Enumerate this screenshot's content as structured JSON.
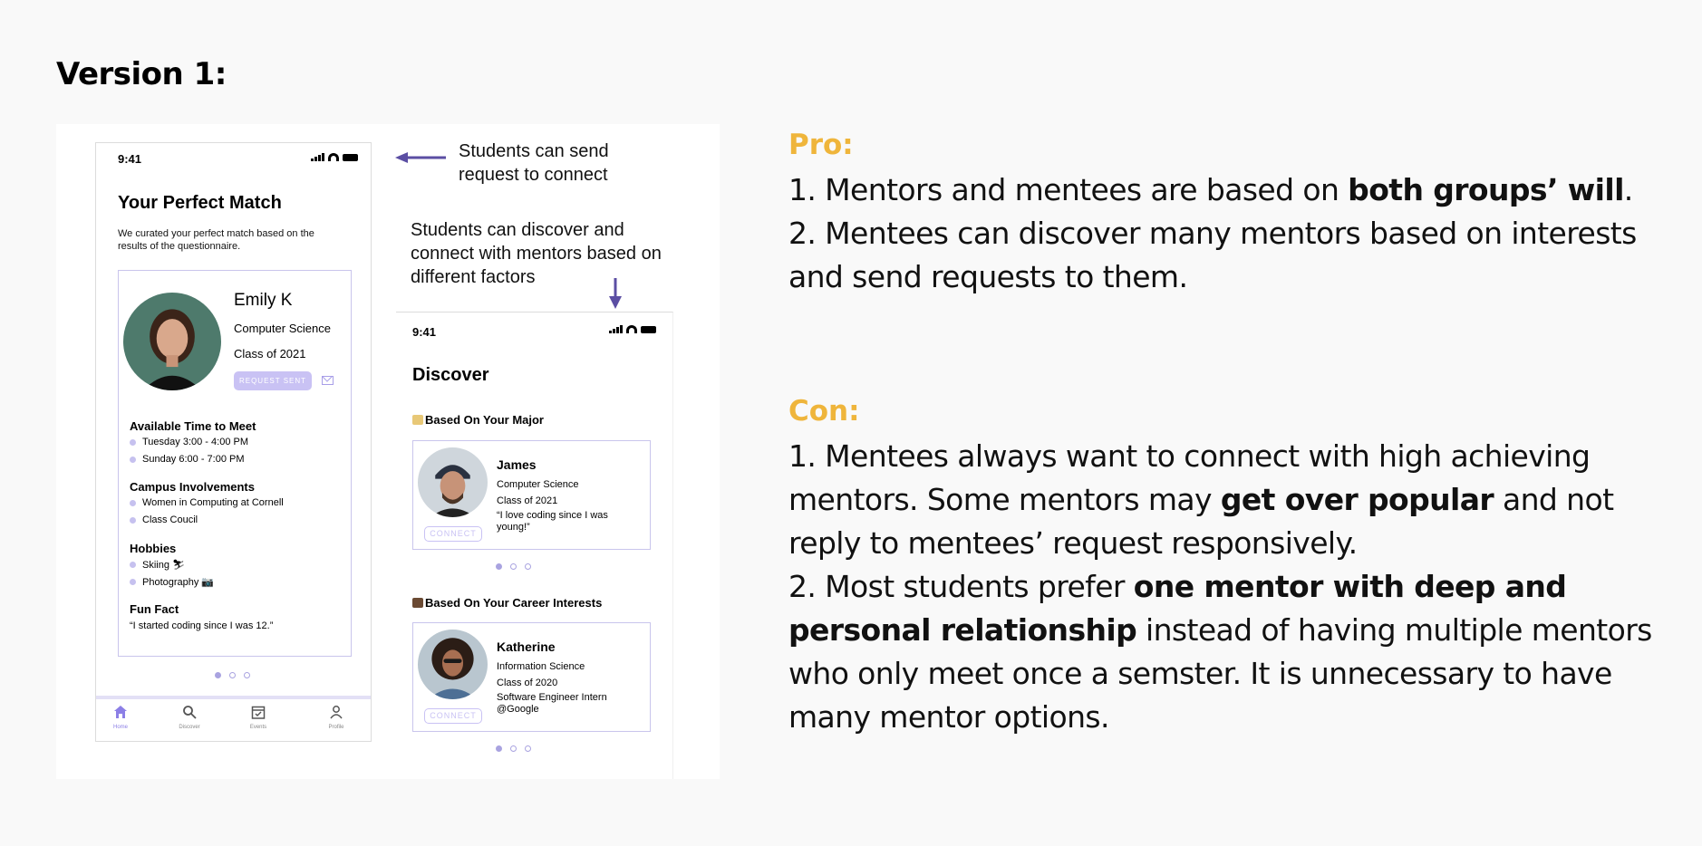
{
  "slide": {
    "title": "Version 1:"
  },
  "phone1": {
    "time": "9:41",
    "title": "Your Perfect Match",
    "subtitle": "We curated your perfect match based on the results of the questionnaire.",
    "profile": {
      "name": "Emily K",
      "major": "Computer Science",
      "class": "Class of 2021",
      "button": "REQUEST SENT"
    },
    "sections": [
      {
        "heading": "Available Time to Meet",
        "items": [
          "Tuesday 3:00 - 4:00 PM",
          "Sunday 6:00 - 7:00 PM"
        ]
      },
      {
        "heading": "Campus Involvements",
        "items": [
          "Women in Computing at Cornell",
          "Class Coucil"
        ]
      },
      {
        "heading": "Hobbies",
        "items": [
          "Skiing ⛷",
          "Photography 📷"
        ]
      },
      {
        "heading": "Fun Fact",
        "quote": "“I started coding since I was 12.”"
      }
    ],
    "tabs": [
      "Home",
      "Discover",
      "Events",
      "Profile"
    ]
  },
  "annotations": {
    "note1": "Students can send request to connect",
    "note2": "Students can discover and connect with mentors based on different factors"
  },
  "phone2": {
    "time": "9:41",
    "title": "Discover",
    "categories": [
      {
        "heading": "Based On Your Major",
        "mentor": {
          "name": "James",
          "major": "Computer Science",
          "class": "Class of 2021",
          "extra": "“I love coding since I was young!”",
          "button": "CONNECT"
        }
      },
      {
        "heading": "Based On Your Career Interests",
        "mentor": {
          "name": "Katherine",
          "major": "Information Science",
          "class": "Class of 2020",
          "extra": "Software Engineer Intern @Google",
          "button": "CONNECT"
        }
      }
    ]
  },
  "pro": {
    "label": "Pro:",
    "p1_pre": "1. Mentors and mentees are based on ",
    "p1_bold": "both groups’ will",
    "p1_post": ".",
    "p2": "2. Mentees can discover many mentors based on interests and send requests to them."
  },
  "con": {
    "label": "Con:",
    "p1_pre": "1. Mentees always want to connect with high achieving mentors. Some mentors may ",
    "p1_bold": "get over popular",
    "p1_post": " and not reply to mentees’ request responsively.",
    "p2_pre": "2. Most students prefer ",
    "p2_bold": "one mentor with deep and personal relationship",
    "p2_post": " instead of having multiple mentors who only meet once a semster. It is unnecessary to have many mentor options."
  },
  "colors": {
    "accent": "#efb53b",
    "purple": "#5b4ea3",
    "light_purple": "#c9c2f4"
  }
}
